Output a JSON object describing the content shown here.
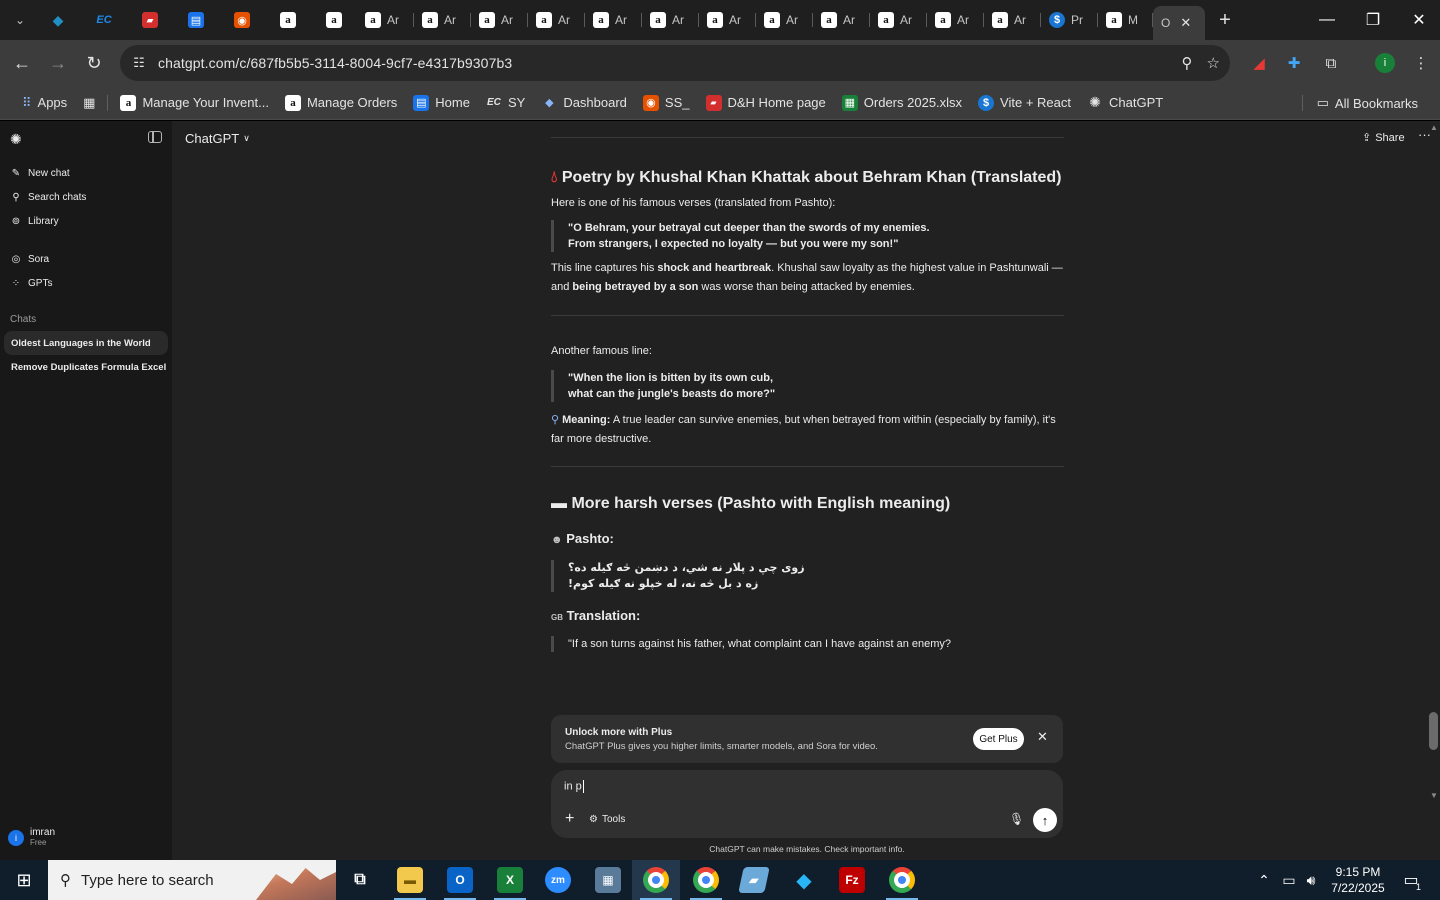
{
  "tabs": {
    "pinned": [
      {
        "icon": "hex-app-icon",
        "glyph": "◆",
        "color": "#1f8fc4"
      },
      {
        "icon": "ec-icon",
        "glyph": "EC",
        "color": "#1e88e5"
      },
      {
        "icon": "dh-icon",
        "glyph": "▰",
        "color": "#d32f2f"
      },
      {
        "icon": "docs-icon",
        "glyph": "▤",
        "color": "#1a73e8"
      },
      {
        "icon": "ss-icon",
        "glyph": "◉",
        "color": "#e65100"
      },
      {
        "icon": "amazon-icon",
        "glyph": "a",
        "color": "#ffffff"
      },
      {
        "icon": "amazon-icon",
        "glyph": "a",
        "color": "#ffffff"
      }
    ],
    "amazon_tabs": [
      "Ar",
      "Ar",
      "Ar",
      "Ar",
      "Ar",
      "Ar",
      "Ar",
      "Ar",
      "Ar",
      "Ar",
      "Ar",
      "Ar"
    ],
    "pr_tab": "Pr",
    "m_tab": "M",
    "active_tab": "O",
    "active_tab_close": "✕"
  },
  "omnibox": {
    "url": "chatgpt.com/c/687fb5b5-3114-8004-9cf7-e4317b9307b3"
  },
  "bookmarks": {
    "items": [
      {
        "label": "Apps",
        "icon": "apps-grid-icon"
      },
      {
        "label": "",
        "icon": "tab-groups-icon"
      },
      {
        "label": "Manage Your Invent...",
        "icon": "amazon-icon"
      },
      {
        "label": "Manage Orders",
        "icon": "amazon-icon"
      },
      {
        "label": "Home",
        "icon": "docs-icon"
      },
      {
        "label": "SY",
        "icon": "ec-icon"
      },
      {
        "label": "Dashboard",
        "icon": "hex-app-icon"
      },
      {
        "label": "SS_",
        "icon": "ss-icon"
      },
      {
        "label": "D&H Home page",
        "icon": "dh-icon"
      },
      {
        "label": "Orders 2025.xlsx",
        "icon": "excel-icon"
      },
      {
        "label": "Vite + React",
        "icon": "dollar-icon"
      },
      {
        "label": "ChatGPT",
        "icon": "chatgpt-icon"
      }
    ],
    "all_bookmarks": "All Bookmarks"
  },
  "sidebar": {
    "nav": [
      {
        "label": "New chat",
        "icon": "edit-icon"
      },
      {
        "label": "Search chats",
        "icon": "search-icon"
      },
      {
        "label": "Library",
        "icon": "library-icon"
      }
    ],
    "apps": [
      {
        "label": "Sora",
        "icon": "sora-icon"
      },
      {
        "label": "GPTs",
        "icon": "gpts-icon"
      }
    ],
    "chats_heading": "Chats",
    "chats": [
      "Oldest Languages in the World",
      "Remove Duplicates Formula Excel"
    ],
    "user": {
      "initial": "i",
      "name": "imran",
      "plan": "Free"
    }
  },
  "header": {
    "model": "ChatGPT",
    "share": "Share"
  },
  "conversation": {
    "h1": "Poetry by Khushal Khan Khattak about Behram Khan (Translated)",
    "intro": "Here is one of his famous verses (translated from Pashto):",
    "quote1_line1": "\"O Behram, your betrayal cut deeper than the swords of my enemies.",
    "quote1_line2": "From strangers, I expected no loyalty — but you were my son!\"",
    "p1_a": "This line captures his ",
    "p1_b": "shock and heartbreak",
    "p1_c": ". Khushal saw loyalty as the highest value in Pashtunwali — and ",
    "p1_d": "being betrayed by a son",
    "p1_e": " was worse than being attacked by enemies.",
    "another": "Another famous line:",
    "quote2_line1": "\"When the lion is bitten by its own cub,",
    "quote2_line2": "what can the jungle's beasts do more?\"",
    "meaning_label": "Meaning:",
    "meaning_text": " A true leader can survive enemies, but when betrayed from within (especially by family), it's far more destructive.",
    "h2": "More harsh verses (Pashto with English meaning)",
    "pashto_label": "Pashto:",
    "pashto_line1": "زوی چې د پلار نه شي، د دښمن څه ګیله ده؟",
    "pashto_line2": "زه د بل څه نه، له خپلو نه ګیله کوم!",
    "translation_label": "Translation:",
    "translation_line1": "\"If a son turns against his father, what complaint can I have against an enemy?"
  },
  "upsell": {
    "title": "Unlock more with Plus",
    "subtitle": "ChatGPT Plus gives you higher limits, smarter models, and Sora for video.",
    "button": "Get Plus"
  },
  "composer": {
    "value": "in p",
    "tools": "Tools"
  },
  "disclaimer": "ChatGPT can make mistakes. Check important info.",
  "taskbar": {
    "search_placeholder": "Type here to search",
    "time": "9:15 PM",
    "date": "7/22/2025",
    "notifications": "1"
  }
}
